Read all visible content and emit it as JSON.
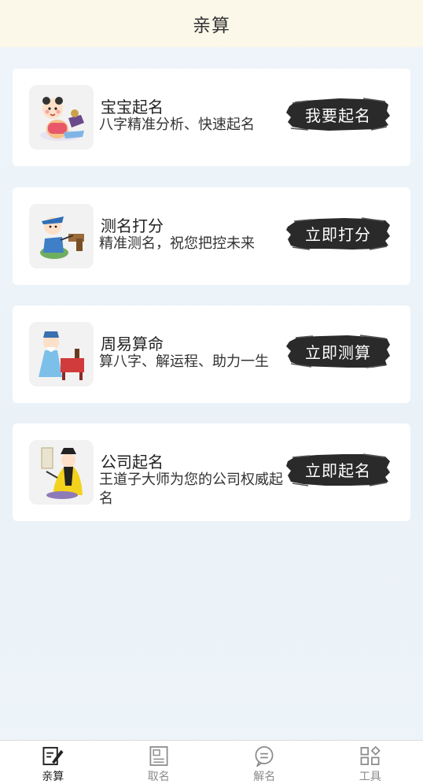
{
  "header": {
    "title": "亲算"
  },
  "cards": [
    {
      "title": "宝宝起名",
      "desc": "八字精准分析、快速起名",
      "button": "我要起名",
      "icon": "baby-cartoon-icon"
    },
    {
      "title": "测名打分",
      "desc": "精准测名，祝您把控未来",
      "button": "立即打分",
      "icon": "scholar-writing-icon"
    },
    {
      "title": "周易算命",
      "desc": "算八字、解运程、助力一生",
      "button": "立即测算",
      "icon": "fortune-teller-icon"
    },
    {
      "title": "公司起名",
      "desc": "王道子大师为您的公司权威起名",
      "button": "立即起名",
      "icon": "master-calligraphy-icon"
    }
  ],
  "tabbar": {
    "active_index": 0,
    "tabs": [
      {
        "label": "亲算",
        "icon": "pen-paper-icon"
      },
      {
        "label": "取名",
        "icon": "name-card-icon"
      },
      {
        "label": "解名",
        "icon": "chat-bubble-icon"
      },
      {
        "label": "工具",
        "icon": "grid-tools-icon"
      }
    ]
  },
  "colors": {
    "header_bg": "#fbf8ea",
    "page_bg": "#edf4f9",
    "button_ink": "#2b2b2b",
    "card_bg": "#ffffff"
  }
}
